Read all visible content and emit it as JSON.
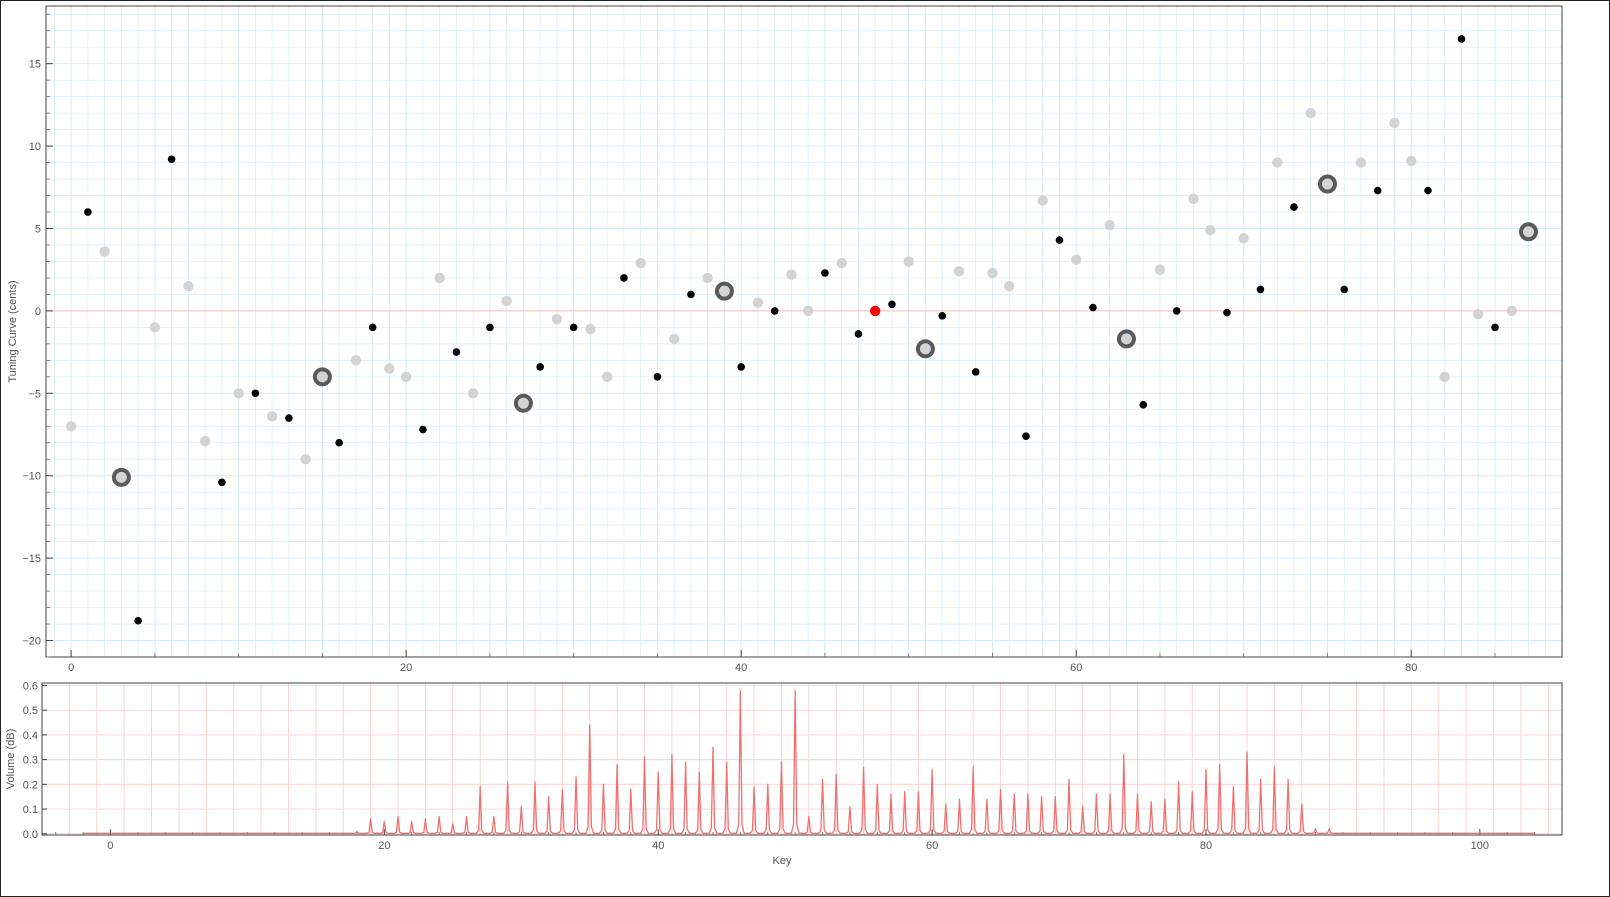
{
  "chart_data": [
    {
      "type": "scatter",
      "title": "",
      "xlabel": "",
      "ylabel": "Tuning Curve (cents)",
      "xlim": [
        -1.5,
        89
      ],
      "ylim": [
        -21,
        18.5
      ],
      "grid": true,
      "x_ticks": [
        0,
        20,
        40,
        60,
        80
      ],
      "y_ticks": [
        -20,
        -15,
        -10,
        -5,
        0,
        5,
        10,
        15
      ],
      "colors": {
        "black_key": "#000000",
        "white_key": "#d3d3d3",
        "reference": "#ff0000",
        "ring": "#5a5a5a",
        "grid": "#d6ebfa",
        "zero_line": "#f8c8c8"
      },
      "series": [
        {
          "role": "black-keys",
          "x": [
            1,
            4,
            6,
            9,
            11,
            13,
            16,
            18,
            21,
            23,
            25,
            28,
            30,
            33,
            35,
            37,
            40,
            42,
            45,
            47,
            49,
            52,
            54,
            57,
            59,
            61,
            64,
            66,
            69,
            71,
            73,
            76,
            78,
            81,
            83,
            85
          ],
          "y": [
            6.0,
            -18.8,
            9.2,
            -10.4,
            -5.0,
            -6.5,
            -8.0,
            -1.0,
            -7.2,
            -2.5,
            -1.0,
            -3.4,
            -1.0,
            2.0,
            -4.0,
            1.0,
            -3.4,
            0.0,
            2.3,
            -1.4,
            0.4,
            -0.3,
            -3.7,
            -7.6,
            4.3,
            0.2,
            -5.7,
            0.0,
            -0.1,
            1.3,
            6.3,
            1.3,
            7.3,
            7.3,
            16.5,
            -1.0
          ]
        },
        {
          "role": "white-keys",
          "x": [
            0,
            2,
            5,
            7,
            8,
            10,
            12,
            14,
            17,
            19,
            20,
            22,
            24,
            26,
            29,
            31,
            32,
            34,
            36,
            38,
            41,
            43,
            44,
            46,
            50,
            53,
            55,
            56,
            58,
            60,
            62,
            65,
            67,
            68,
            70,
            72,
            74,
            77,
            79,
            80,
            82,
            84,
            86
          ],
          "y": [
            -7.0,
            3.6,
            -1.0,
            1.5,
            -7.9,
            -5.0,
            -6.4,
            -9.0,
            -3.0,
            -3.5,
            -4.0,
            2.0,
            -5.0,
            0.6,
            -0.5,
            -1.1,
            -4.0,
            2.9,
            -1.7,
            2.0,
            0.5,
            2.2,
            0.0,
            2.9,
            3.0,
            2.4,
            2.3,
            1.5,
            6.7,
            3.1,
            5.2,
            2.5,
            6.8,
            4.9,
            4.4,
            9.0,
            12.0,
            9.0,
            11.4,
            9.1,
            -4.0,
            -0.2,
            0.0
          ]
        },
        {
          "role": "reference-key",
          "x": [
            48
          ],
          "y": [
            0.0
          ]
        },
        {
          "role": "ringed-keys",
          "x": [
            3,
            15,
            27,
            39,
            51,
            63,
            75,
            87
          ],
          "y": [
            -10.1,
            -4.0,
            -5.6,
            1.2,
            -2.3,
            -1.7,
            7.7,
            4.8
          ]
        }
      ]
    },
    {
      "type": "line",
      "title": "",
      "xlabel": "Key",
      "ylabel": "Volume (dB)",
      "xlim": [
        -5,
        106
      ],
      "ylim": [
        -0.005,
        0.61
      ],
      "grid": true,
      "x_ticks": [
        0,
        20,
        40,
        60,
        80,
        100
      ],
      "y_ticks": [
        0.0,
        0.1,
        0.2,
        0.3,
        0.4,
        0.5,
        0.6
      ],
      "y_tick_labels": [
        "0.0",
        "0.1",
        "0.2",
        "0.3",
        "0.4",
        "0.5",
        "0.6"
      ],
      "colors": {
        "line": "#f07070",
        "grid": "#fad0d0"
      },
      "line_range": [
        -2,
        104
      ],
      "peaks": {
        "x": [
          18,
          19,
          20,
          21,
          22,
          23,
          24,
          25,
          26,
          27,
          28,
          29,
          30,
          31,
          32,
          33,
          34,
          35,
          36,
          37,
          38,
          39,
          40,
          41,
          42,
          43,
          44,
          45,
          46,
          47,
          48,
          49,
          50,
          51,
          52,
          53,
          54,
          55,
          56,
          57,
          58,
          59,
          60,
          61,
          62,
          63,
          64,
          65,
          66,
          67,
          68,
          69,
          70,
          71,
          72,
          73,
          74,
          75,
          76,
          77,
          78,
          79,
          80,
          81,
          82,
          83,
          84,
          85,
          86,
          87,
          88,
          89
        ],
        "y": [
          0.01,
          0.06,
          0.05,
          0.07,
          0.05,
          0.06,
          0.07,
          0.04,
          0.07,
          0.19,
          0.07,
          0.21,
          0.11,
          0.21,
          0.15,
          0.18,
          0.23,
          0.44,
          0.2,
          0.28,
          0.18,
          0.31,
          0.25,
          0.32,
          0.29,
          0.25,
          0.35,
          0.29,
          0.58,
          0.19,
          0.2,
          0.29,
          0.58,
          0.07,
          0.22,
          0.24,
          0.11,
          0.27,
          0.2,
          0.16,
          0.17,
          0.17,
          0.26,
          0.12,
          0.14,
          0.27,
          0.14,
          0.18,
          0.16,
          0.16,
          0.15,
          0.15,
          0.22,
          0.11,
          0.16,
          0.16,
          0.32,
          0.16,
          0.13,
          0.14,
          0.21,
          0.17,
          0.26,
          0.28,
          0.19,
          0.33,
          0.22,
          0.27,
          0.22,
          0.12,
          0.02,
          0.02
        ]
      }
    }
  ]
}
